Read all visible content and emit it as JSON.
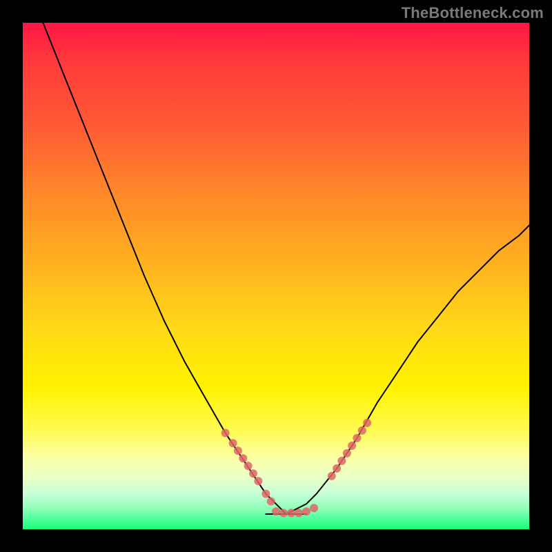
{
  "watermark": "TheBottleneck.com",
  "chart_data": {
    "type": "line",
    "title": "",
    "xlabel": "",
    "ylabel": "",
    "xlim": [
      0,
      100
    ],
    "ylim": [
      0,
      100
    ],
    "grid": false,
    "series": [
      {
        "name": "left-curve",
        "color": "#000000",
        "x": [
          4,
          8,
          12,
          16,
          20,
          24,
          28,
          32,
          36,
          40,
          44,
          46,
          48,
          50,
          52
        ],
        "y": [
          100,
          90,
          80,
          70,
          60,
          50,
          41,
          33,
          26,
          19,
          13,
          10,
          7,
          5,
          3
        ]
      },
      {
        "name": "right-curve",
        "color": "#000000",
        "x": [
          52,
          54,
          56,
          58,
          62,
          66,
          70,
          74,
          78,
          82,
          86,
          90,
          94,
          98,
          100
        ],
        "y": [
          3,
          4,
          5,
          7,
          12,
          18,
          25,
          31,
          37,
          42,
          47,
          51,
          55,
          58,
          60
        ]
      },
      {
        "name": "flat-bottom",
        "color": "#000000",
        "x": [
          48,
          50,
          52,
          54,
          56
        ],
        "y": [
          3,
          3,
          3,
          3,
          3
        ]
      }
    ],
    "annotations": {
      "dot_clusters": [
        {
          "name": "left-dots",
          "color": "#e06666",
          "x": [
            40,
            41.5,
            42.5,
            43.5,
            44.5,
            45.5,
            46.5,
            48,
            49
          ],
          "y": [
            19,
            17,
            15.5,
            14,
            12.5,
            11,
            9.5,
            7,
            5.5
          ]
        },
        {
          "name": "bottom-dots",
          "color": "#e06666",
          "x": [
            50,
            51.5,
            53,
            54.5,
            56,
            57.5
          ],
          "y": [
            3.5,
            3.2,
            3.2,
            3.2,
            3.5,
            4.2
          ]
        },
        {
          "name": "right-dots",
          "color": "#e06666",
          "x": [
            61,
            62,
            63,
            64,
            65,
            66,
            67,
            68
          ],
          "y": [
            10.5,
            12,
            13.5,
            15,
            16.5,
            18,
            19.5,
            21
          ]
        }
      ]
    }
  }
}
